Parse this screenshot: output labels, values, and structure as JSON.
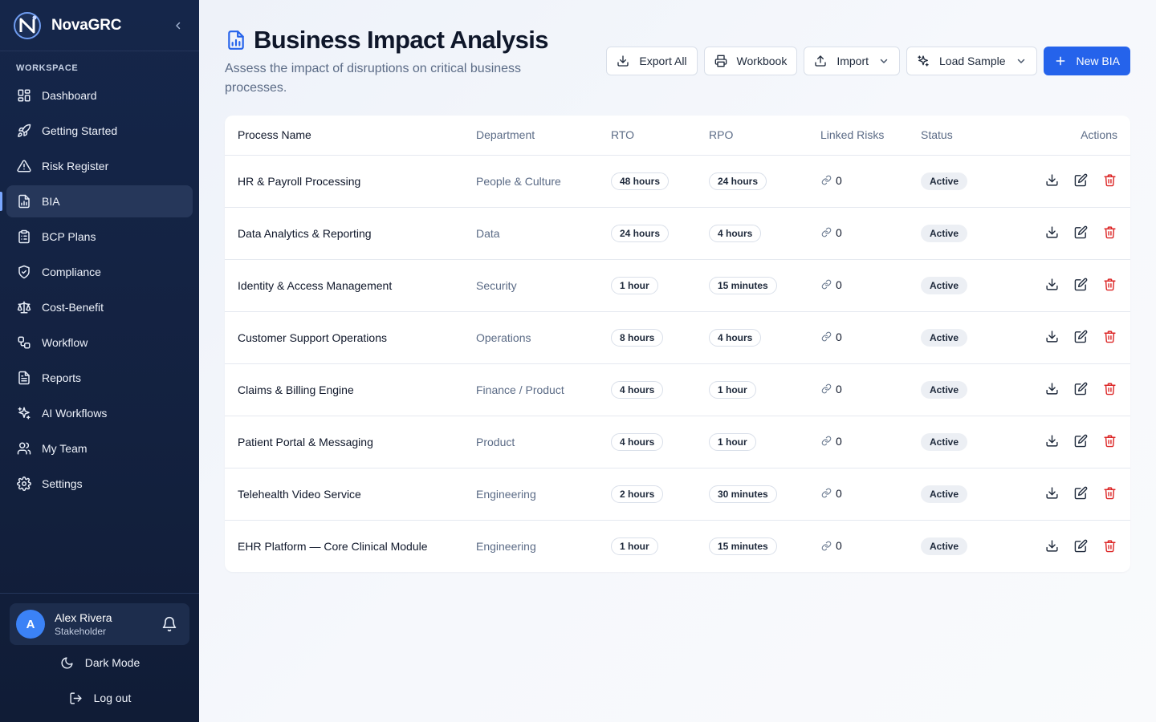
{
  "brand": {
    "name": "NovaGRC"
  },
  "sidebar": {
    "section_label": "WORKSPACE",
    "items": [
      {
        "label": "Dashboard",
        "icon": "layout-dashboard-icon"
      },
      {
        "label": "Getting Started",
        "icon": "rocket-icon"
      },
      {
        "label": "Risk Register",
        "icon": "alert-triangle-icon"
      },
      {
        "label": "BIA",
        "icon": "file-chart-icon",
        "active": true
      },
      {
        "label": "BCP Plans",
        "icon": "clipboard-list-icon"
      },
      {
        "label": "Compliance",
        "icon": "shield-check-icon"
      },
      {
        "label": "Cost-Benefit",
        "icon": "scale-icon"
      },
      {
        "label": "Workflow",
        "icon": "workflow-icon"
      },
      {
        "label": "Reports",
        "icon": "file-text-icon"
      },
      {
        "label": "AI Workflows",
        "icon": "sparkles-icon"
      },
      {
        "label": "My Team",
        "icon": "users-icon"
      },
      {
        "label": "Settings",
        "icon": "settings-icon"
      }
    ],
    "user": {
      "initial": "A",
      "name": "Alex Rivera",
      "role": "Stakeholder"
    },
    "dark_mode_label": "Dark Mode",
    "logout_label": "Log out"
  },
  "header": {
    "title": "Business Impact Analysis",
    "subtitle": "Assess the impact of disruptions on critical business processes."
  },
  "toolbar": {
    "export_all": "Export All",
    "workbook": "Workbook",
    "import": "Import",
    "load_sample": "Load Sample",
    "new_bia": "New BIA"
  },
  "table": {
    "columns": [
      "Process Name",
      "Department",
      "RTO",
      "RPO",
      "Linked Risks",
      "Status",
      "Actions"
    ],
    "rows": [
      {
        "name": "HR & Payroll Processing",
        "department": "People & Culture",
        "rto": "48 hours",
        "rpo": "24 hours",
        "linked_risks": "0",
        "status": "Active"
      },
      {
        "name": "Data Analytics & Reporting",
        "department": "Data",
        "rto": "24 hours",
        "rpo": "4 hours",
        "linked_risks": "0",
        "status": "Active"
      },
      {
        "name": "Identity & Access Management",
        "department": "Security",
        "rto": "1 hour",
        "rpo": "15 minutes",
        "linked_risks": "0",
        "status": "Active"
      },
      {
        "name": "Customer Support Operations",
        "department": "Operations",
        "rto": "8 hours",
        "rpo": "4 hours",
        "linked_risks": "0",
        "status": "Active"
      },
      {
        "name": "Claims & Billing Engine",
        "department": "Finance / Product",
        "rto": "4 hours",
        "rpo": "1 hour",
        "linked_risks": "0",
        "status": "Active"
      },
      {
        "name": "Patient Portal & Messaging",
        "department": "Product",
        "rto": "4 hours",
        "rpo": "1 hour",
        "linked_risks": "0",
        "status": "Active"
      },
      {
        "name": "Telehealth Video Service",
        "department": "Engineering",
        "rto": "2 hours",
        "rpo": "30 minutes",
        "linked_risks": "0",
        "status": "Active"
      },
      {
        "name": "EHR Platform — Core Clinical Module",
        "department": "Engineering",
        "rto": "1 hour",
        "rpo": "15 minutes",
        "linked_risks": "0",
        "status": "Active"
      }
    ]
  },
  "colors": {
    "sidebar_bg": "#15264a",
    "accent": "#2563eb",
    "delete": "#dc2626",
    "status_badge_bg": "#eceff4"
  }
}
